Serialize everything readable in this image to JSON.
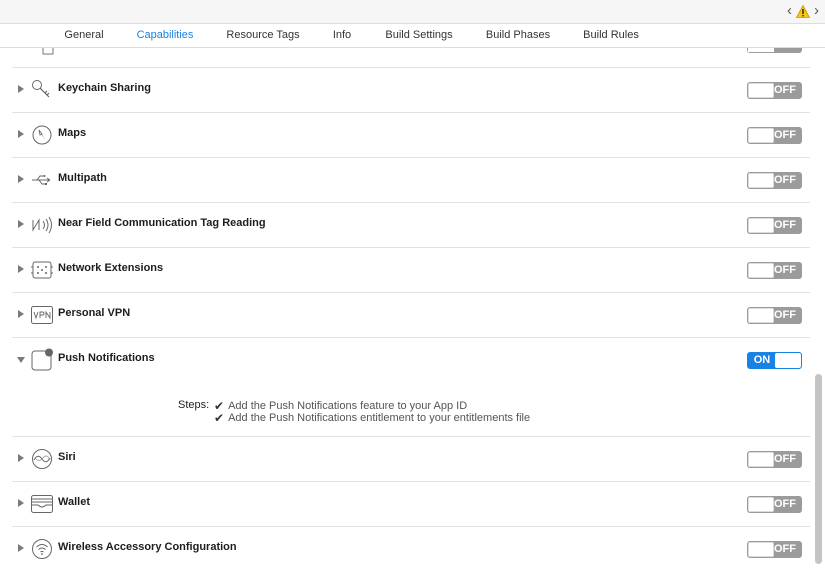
{
  "tabs": [
    {
      "label": "General",
      "active": false
    },
    {
      "label": "Capabilities",
      "active": true
    },
    {
      "label": "Resource Tags",
      "active": false
    },
    {
      "label": "Info",
      "active": false
    },
    {
      "label": "Build Settings",
      "active": false
    },
    {
      "label": "Build Phases",
      "active": false
    },
    {
      "label": "Build Rules",
      "active": false
    }
  ],
  "colors": {
    "accent": "#1a82e2",
    "switch_off": "#9b9b9b",
    "warning": "#f5c518"
  },
  "capabilities": [
    {
      "label": "Keychain Sharing",
      "icon": "key-icon",
      "state": "OFF",
      "expanded": false
    },
    {
      "label": "Maps",
      "icon": "compass-icon",
      "state": "OFF",
      "expanded": false
    },
    {
      "label": "Multipath",
      "icon": "usb-icon",
      "state": "OFF",
      "expanded": false
    },
    {
      "label": "Near Field Communication Tag Reading",
      "icon": "nfc-icon",
      "state": "OFF",
      "expanded": false
    },
    {
      "label": "Network Extensions",
      "icon": "chip-icon",
      "state": "OFF",
      "expanded": false
    },
    {
      "label": "Personal VPN",
      "icon": "vpn-icon",
      "state": "OFF",
      "expanded": false
    },
    {
      "label": "Push Notifications",
      "icon": "notification-icon",
      "state": "ON",
      "expanded": true
    },
    {
      "label": "Siri",
      "icon": "siri-icon",
      "state": "OFF",
      "expanded": false
    },
    {
      "label": "Wallet",
      "icon": "wallet-icon",
      "state": "OFF",
      "expanded": false
    },
    {
      "label": "Wireless Accessory Configuration",
      "icon": "wifi-icon",
      "state": "OFF",
      "expanded": false
    }
  ],
  "push_steps": {
    "label": "Steps:",
    "items": [
      "Add the Push Notifications feature to your App ID",
      "Add the Push Notifications entitlement to your entitlements file"
    ]
  }
}
